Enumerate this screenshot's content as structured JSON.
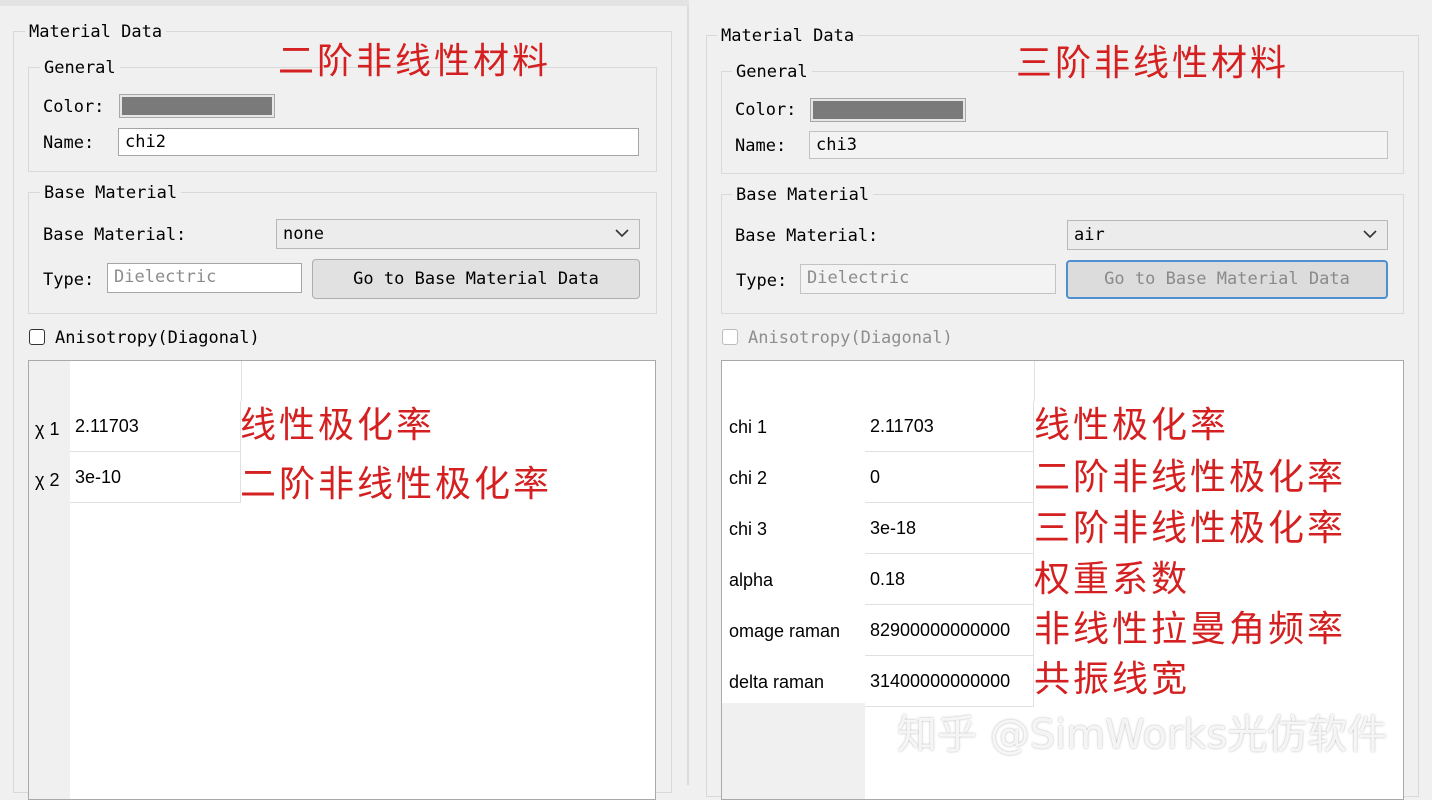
{
  "left": {
    "group_title": "Material Data",
    "annotation_title": "二阶非线性材料",
    "general_title": "General",
    "color_label": "Color:",
    "name_label": "Name:",
    "name_value": "chi2",
    "base_group_title": "Base Material",
    "base_label": "Base Material:",
    "base_value": "none",
    "type_label": "Type:",
    "type_value": "Dielectric",
    "goto_button": "Go to Base Material Data",
    "aniso_label": "Anisotropy(Diagonal)",
    "rows": [
      {
        "label": "χ 1",
        "value": "2.11703",
        "note": "线性极化率"
      },
      {
        "label": "χ 2",
        "value": "3e-10",
        "note": "二阶非线性极化率"
      }
    ]
  },
  "right": {
    "group_title": "Material Data",
    "annotation_title": "三阶非线性材料",
    "general_title": "General",
    "color_label": "Color:",
    "name_label": "Name:",
    "name_value": "chi3",
    "base_group_title": "Base Material",
    "base_label": "Base Material:",
    "base_value": "air",
    "type_label": "Type:",
    "type_value": "Dielectric",
    "goto_button": "Go to Base Material Data",
    "aniso_label": "Anisotropy(Diagonal)",
    "rows": [
      {
        "label": "chi 1",
        "value": "2.11703",
        "note": "线性极化率"
      },
      {
        "label": "chi 2",
        "value": "0",
        "note": "二阶非线性极化率"
      },
      {
        "label": "chi 3",
        "value": "3e-18",
        "note": "三阶非线性极化率"
      },
      {
        "label": "alpha",
        "value": "0.18",
        "note": "权重系数"
      },
      {
        "label": "omage raman",
        "value": "82900000000000",
        "note": "非线性拉曼角频率"
      },
      {
        "label": "delta raman",
        "value": "31400000000000",
        "note": "共振线宽"
      }
    ]
  },
  "watermark": "知乎 @SimWorks光仿软件",
  "colors": {
    "swatch": "#7a7a7a",
    "annotation": "#d42020",
    "focus_border": "#4d8fd0"
  }
}
